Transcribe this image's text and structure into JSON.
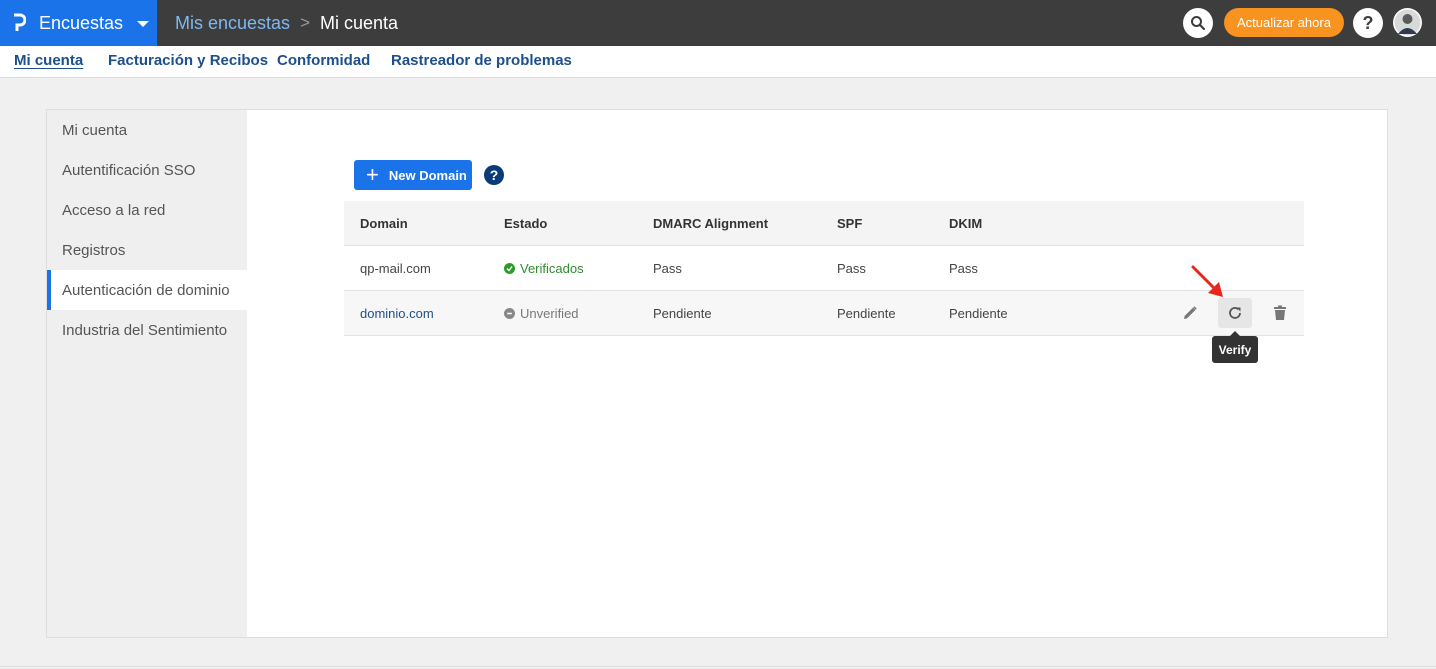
{
  "topbar": {
    "product_name": "Encuestas",
    "breadcrumb_parent": "Mis encuestas",
    "breadcrumb_separator": ">",
    "breadcrumb_current": "Mi cuenta",
    "upgrade_label": "Actualizar ahora",
    "help_label": "?",
    "icons": [
      "questionpro-logo-icon",
      "caret-down-icon",
      "search-icon",
      "help-icon",
      "avatar"
    ]
  },
  "subnav": {
    "items": [
      "Mi cuenta",
      "Facturación y Recibos",
      "Conformidad",
      "Rastreador de problemas"
    ],
    "active": "Mi cuenta"
  },
  "sidebar": {
    "items": [
      {
        "label": "Mi cuenta"
      },
      {
        "label": "Autentificación SSO"
      },
      {
        "label": "Acceso a la red"
      },
      {
        "label": "Registros"
      },
      {
        "label": "Autenticación de dominio"
      },
      {
        "label": "Industria del Sentimiento"
      }
    ],
    "active": "Autenticación de dominio"
  },
  "toolbar": {
    "new_domain_label": "New Domain",
    "help_label": "?"
  },
  "table": {
    "headers": [
      "Domain",
      "Estado",
      "DMARC Alignment",
      "SPF",
      "DKIM"
    ],
    "rows": [
      {
        "domain": "qp-mail.com",
        "status": "Verificados",
        "dmarc": "Pass",
        "spf": "Pass",
        "dkim": "Pass"
      },
      {
        "domain": "dominio.com",
        "status": "Unverified",
        "dmarc": "Pendiente",
        "spf": "Pendiente",
        "dkim": "Pendiente"
      }
    ],
    "row_actions": [
      "edit-icon",
      "refresh-icon",
      "trash-icon"
    ]
  },
  "tooltip": {
    "text": "Verify"
  },
  "colors": {
    "topbar_bg": "#3d3d3d",
    "brand_blue": "#1a73e8",
    "upgrade_orange": "#f7931e",
    "verified_green": "#2e9b2e",
    "arrow_red": "#e8271c"
  }
}
